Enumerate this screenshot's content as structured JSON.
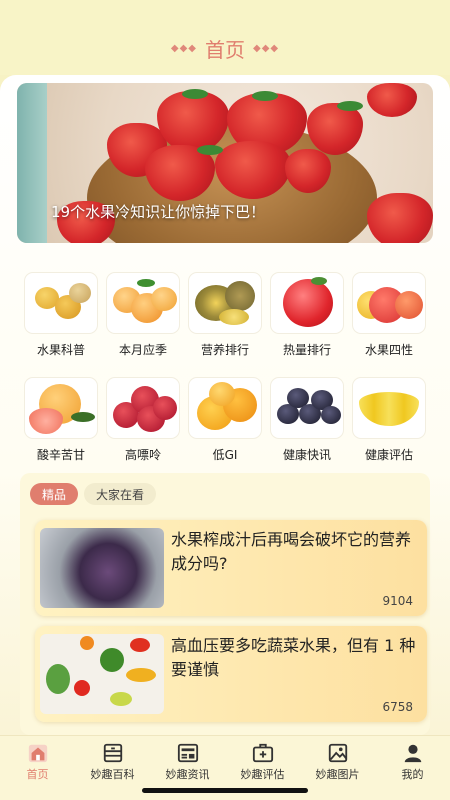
{
  "header": {
    "title": "首页",
    "deco_left": "◆◆◆",
    "deco_right": "◆◆◆"
  },
  "banner": {
    "caption": "19个水果冷知识让你惊掉下巴！"
  },
  "grid": [
    {
      "label": "水果科普",
      "icon": "golden-berries-icon"
    },
    {
      "label": "本月应季",
      "icon": "apricots-icon"
    },
    {
      "label": "营养排行",
      "icon": "durian-icon"
    },
    {
      "label": "热量排行",
      "icon": "apple-icon"
    },
    {
      "label": "水果四性",
      "icon": "apples-icon"
    },
    {
      "label": "酸辛苦甘",
      "icon": "grapefruit-icon"
    },
    {
      "label": "高嘌呤",
      "icon": "bayberry-icon"
    },
    {
      "label": "低GI",
      "icon": "orange-icon"
    },
    {
      "label": "健康快讯",
      "icon": "blackberry-icon"
    },
    {
      "label": "健康评估",
      "icon": "banana-icon"
    }
  ],
  "tabs": {
    "active": "精品",
    "inactive": "大家在看"
  },
  "articles": [
    {
      "title": "水果榨成汁后再喝会破坏它的营养成分吗?",
      "views": "9104"
    },
    {
      "title": "高血压要多吃蔬菜水果，但有 1 种要谨慎",
      "views": "6758"
    }
  ],
  "tabbar": [
    {
      "label": "首页",
      "icon": "home-icon",
      "active": true
    },
    {
      "label": "妙趣百科",
      "icon": "cabinet-icon",
      "active": false
    },
    {
      "label": "妙趣资讯",
      "icon": "news-icon",
      "active": false
    },
    {
      "label": "妙趣评估",
      "icon": "medical-kit-icon",
      "active": false
    },
    {
      "label": "妙趣图片",
      "icon": "image-icon",
      "active": false
    },
    {
      "label": "我的",
      "icon": "user-icon",
      "active": false
    }
  ],
  "colors": {
    "accent": "#e07e6e",
    "background": "#f7f2c4"
  }
}
